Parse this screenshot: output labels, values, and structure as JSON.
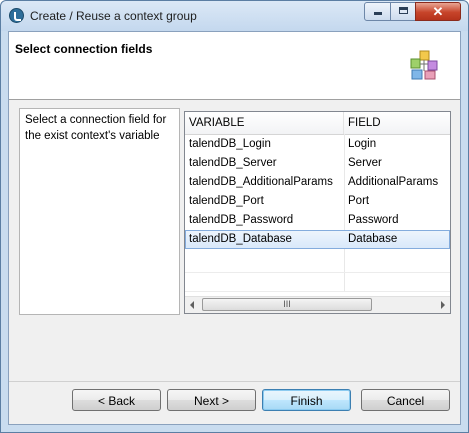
{
  "window": {
    "title": "Create / Reuse a context group",
    "close_glyph": "✕",
    "icons": {
      "app": "talend-app-icon",
      "minimize": "minimize-icon",
      "maximize": "maximize-icon",
      "close": "close-icon",
      "wizard": "context-group-wizard-icon"
    }
  },
  "header": {
    "title": "Select connection fields"
  },
  "description": {
    "text": "Select a connection field for the exist context's variable"
  },
  "table": {
    "columns": [
      "VARIABLE",
      "FIELD"
    ],
    "rows": [
      {
        "variable": "talendDB_Login",
        "field": "Login",
        "selected": false
      },
      {
        "variable": "talendDB_Server",
        "field": "Server",
        "selected": false
      },
      {
        "variable": "talendDB_AdditionalParams",
        "field": "AdditionalParams",
        "selected": false
      },
      {
        "variable": "talendDB_Port",
        "field": "Port",
        "selected": false
      },
      {
        "variable": "talendDB_Password",
        "field": "Password",
        "selected": false
      },
      {
        "variable": "talendDB_Database",
        "field": "Database",
        "selected": true
      }
    ],
    "scrollbar": {
      "thumb_grip": "III"
    }
  },
  "buttons": {
    "back": "< Back",
    "next": "Next >",
    "finish": "Finish",
    "cancel": "Cancel"
  },
  "colors": {
    "selection": "#d8e8fa",
    "default_button_border": "#3c7fb1",
    "close_button": "#c7442a"
  }
}
